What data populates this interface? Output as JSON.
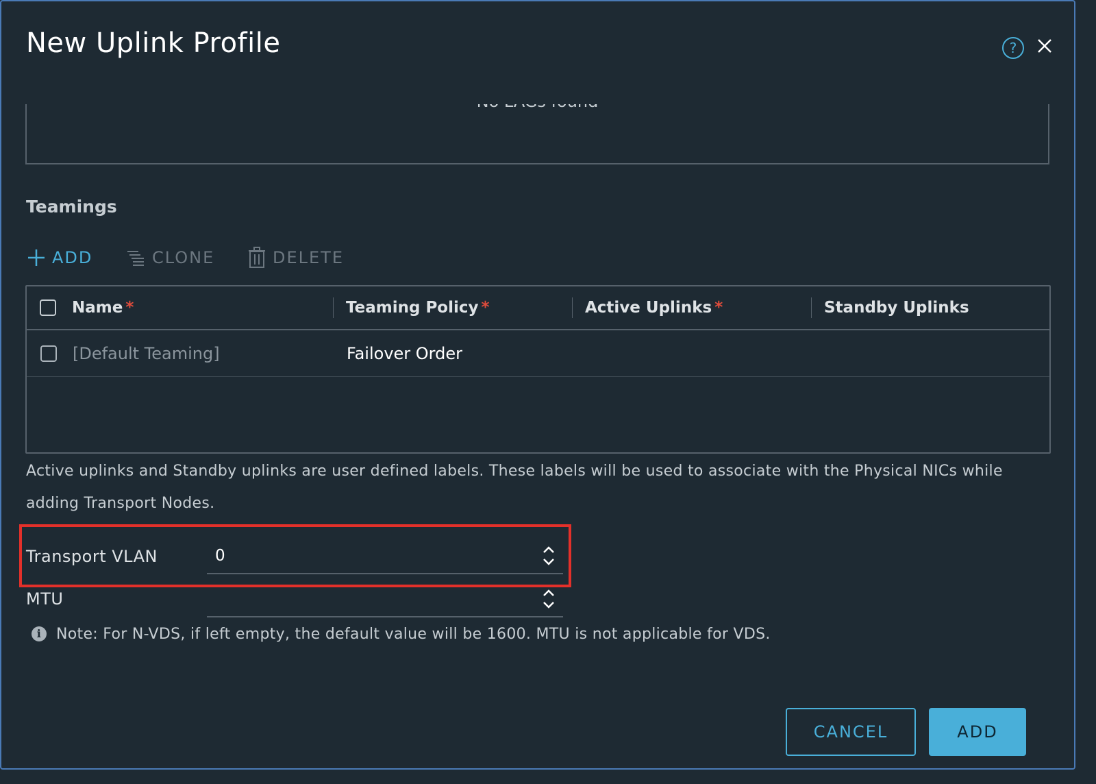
{
  "dialog": {
    "title": "New Uplink Profile",
    "help_icon": "question-circle-icon",
    "close_icon": "close-icon"
  },
  "lags": {
    "empty_text": "No LAGs found"
  },
  "teamings": {
    "section_title": "Teamings",
    "toolbar": {
      "add_label": "ADD",
      "clone_label": "CLONE",
      "delete_label": "DELETE"
    },
    "columns": [
      {
        "label": "Name",
        "required": "*"
      },
      {
        "label": "Teaming Policy",
        "required": "*"
      },
      {
        "label": "Active Uplinks",
        "required": "*"
      },
      {
        "label": "Standby Uplinks",
        "required": ""
      }
    ],
    "rows": [
      {
        "name": "[Default Teaming]",
        "teaming_policy": "Failover Order",
        "active_uplinks": "",
        "standby_uplinks": ""
      }
    ],
    "help_text": "Active uplinks and Standby uplinks are user defined labels. These labels will be used to associate with the Physical NICs while adding Transport Nodes."
  },
  "transport_vlan": {
    "label": "Transport VLAN",
    "value": "0"
  },
  "mtu": {
    "label": "MTU",
    "value": "",
    "note": "Note: For N-VDS, if left empty, the default value will be 1600. MTU is not applicable for VDS."
  },
  "footer": {
    "cancel_label": "CANCEL",
    "add_label": "ADD"
  },
  "colors": {
    "background": "#1e2a33",
    "accent": "#49afd9",
    "highlight": "#e3302a",
    "required": "#e04c3c"
  }
}
